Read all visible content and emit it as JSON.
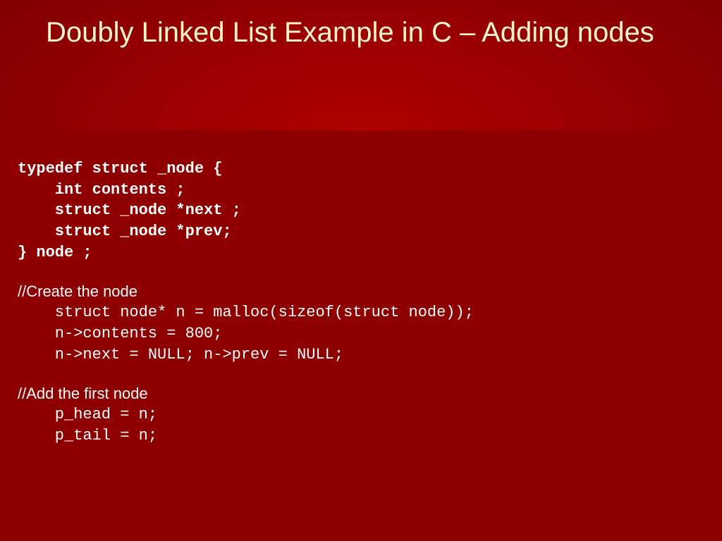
{
  "title": "Doubly Linked List Example in C – Adding nodes",
  "struct_def": "typedef struct _node {\n    int contents ;\n    struct _node *next ;\n    struct _node *prev;\n} node ;",
  "comment_create": "//Create the node",
  "code_create": "    struct node* n = malloc(sizeof(struct node));\n    n->contents = 800;\n    n->next = NULL; n->prev = NULL;",
  "comment_add": "//Add the first node",
  "code_add": "    p_head = n;\n    p_tail = n;"
}
